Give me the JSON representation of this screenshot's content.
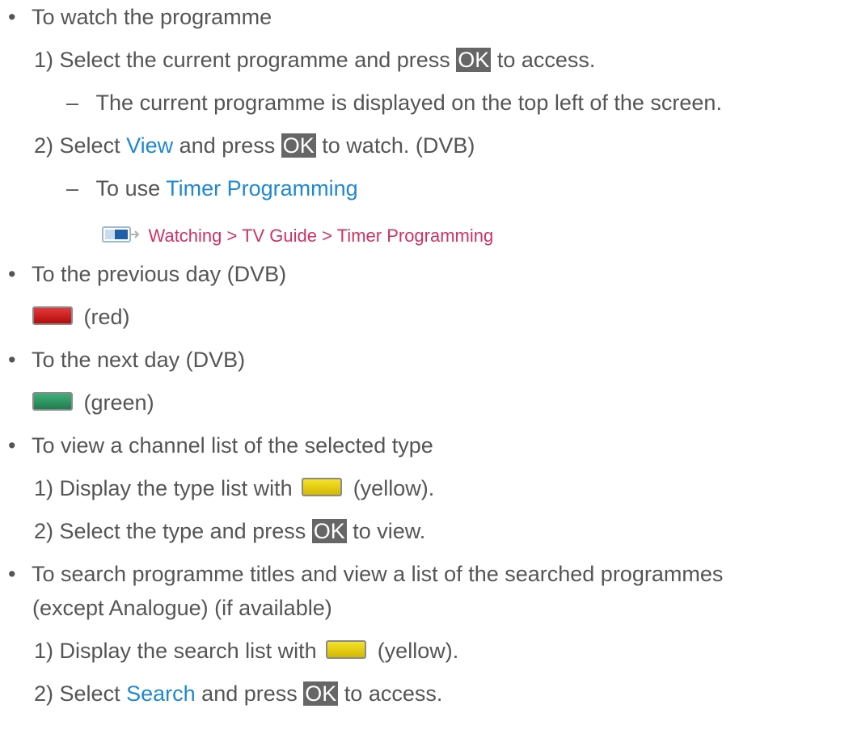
{
  "items": {
    "watch": {
      "bullet": "•",
      "title": "To watch the programme",
      "step1_num": "1)",
      "step1_pre": "Select the current programme and press",
      "step1_ok": "OK",
      "step1_post": "to access.",
      "step1_dash": "–",
      "step1_note": "The current programme is displayed on the top left of the screen.",
      "step2_num": "2)",
      "step2_pre": "Select",
      "step2_link": "View",
      "step2_mid": "and press",
      "step2_ok": "OK",
      "step2_post": "to watch. (DVB)",
      "step2_dash": "–",
      "step2_note_pre": "To use",
      "step2_note_link": "Timer Programming",
      "nav_path": "Watching > TV Guide > Timer Programming"
    },
    "prev_day": {
      "bullet": "•",
      "title": "To the previous day (DVB)",
      "key_label": "(red)"
    },
    "next_day": {
      "bullet": "•",
      "title": "To the next day (DVB)",
      "key_label": "(green)"
    },
    "channel_list": {
      "bullet": "•",
      "title": "To view a channel list of the selected type",
      "step1_num": "1)",
      "step1_pre": "Display the type list with",
      "step1_post": "(yellow).",
      "step2_num": "2)",
      "step2_pre": "Select the type and press",
      "step2_ok": "OK",
      "step2_post": "to view."
    },
    "search": {
      "bullet": "•",
      "title_line1": "To search programme titles and view a list of the searched programmes",
      "title_line2": "(except Analogue) (if available)",
      "step1_num": "1)",
      "step1_pre": "Display the search list with",
      "step1_post": "(yellow).",
      "step2_num": "2)",
      "step2_pre": "Select",
      "step2_link": "Search",
      "step2_mid": "and press",
      "step2_ok": "OK",
      "step2_post": "to access."
    }
  },
  "colors": {
    "text": "#555555",
    "link": "#1e88d0",
    "nav_link": "#cc3366",
    "ok_bg": "#666666",
    "red_key": "#d02020",
    "green_key": "#2e9a63",
    "yellow_key": "#e6cf10"
  },
  "icons": {
    "menu": "tv-menu-icon",
    "arrow": "right-arrow-icon"
  }
}
